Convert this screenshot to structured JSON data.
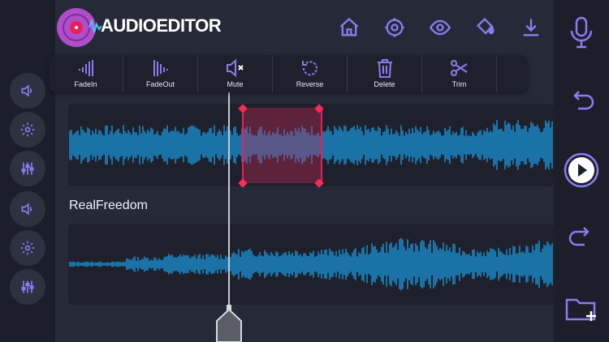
{
  "app": {
    "logo_text": "AUDIOEDITOR"
  },
  "toolbar": {
    "tools": [
      {
        "label": "FadeIn",
        "icon": "fade-in-icon"
      },
      {
        "label": "FadeOut",
        "icon": "fade-out-icon"
      },
      {
        "label": "Mute",
        "icon": "mute-icon"
      },
      {
        "label": "Reverse",
        "icon": "reverse-icon"
      },
      {
        "label": "Delete",
        "icon": "trash-icon"
      },
      {
        "label": "Trim",
        "icon": "scissors-icon"
      }
    ],
    "more_icon": "chevron-right-icon"
  },
  "tracks": [
    {
      "name": ""
    },
    {
      "name": "RealFreedom"
    }
  ],
  "colors": {
    "accent": "#8a7cf0",
    "waveform": "#1a9fe8",
    "selection": "#e5205a",
    "panel": "#1e212c",
    "background": "#262a38"
  },
  "top_icons": [
    "home-icon",
    "gear-icon",
    "eye-icon",
    "paint-bucket-icon",
    "download-icon"
  ],
  "left_icons": [
    "speaker-icon",
    "gear-icon",
    "mixer-sliders-icon",
    "speaker-icon",
    "gear-icon",
    "mixer-sliders-icon"
  ],
  "right_icons": [
    "microphone-icon",
    "undo-icon",
    "play-icon",
    "redo-icon",
    "add-folder-icon"
  ]
}
